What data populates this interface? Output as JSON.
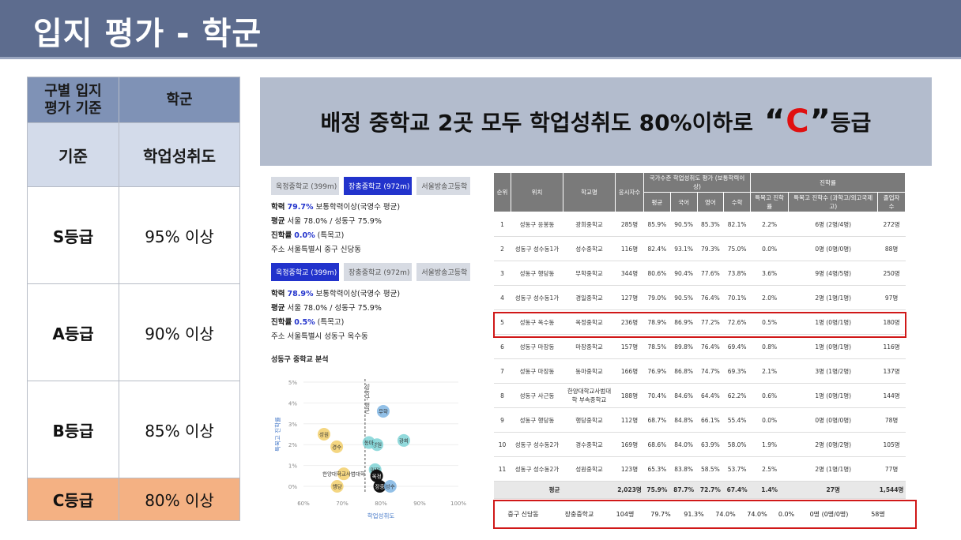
{
  "title": "입지 평가 - 학군",
  "grade_table": {
    "header_col1_line1": "구별 입지",
    "header_col1_line2": "평가 기준",
    "header_col2": "학군",
    "sub_col1": "기준",
    "sub_col2": "학업성취도",
    "rows": [
      {
        "grade": "S등급",
        "value": "95% 이상"
      },
      {
        "grade": "A등급",
        "value": "90% 이상"
      },
      {
        "grade": "B등급",
        "value": "85% 이상"
      },
      {
        "grade": "C등급",
        "value": "80% 이상"
      }
    ]
  },
  "banner": {
    "prefix": "배정 중학교 2곳 모두 학업성취도 80%이하로",
    "open_quote": "“",
    "grade": "C",
    "close_quote": "”",
    "suffix": "등급"
  },
  "panel1": {
    "tabs": [
      "옥정중학교 (399m)",
      "장충중학교 (972m)",
      "서울방송고등학"
    ],
    "active_tab": 1,
    "line1_label": "학력",
    "line1_value": "79.7%",
    "line1_rest": "보통학력이상(국영수 평균)",
    "line2_label": "평균",
    "line2_rest": "서울 78.0% / 성동구 75.9%",
    "line3_label": "진학률",
    "line3_value": "0.0%",
    "line3_rest": "(특목고)",
    "line4": "주소 서울특별시 중구 신당동"
  },
  "panel2": {
    "tabs": [
      "옥정중학교 (399m)",
      "장충중학교 (972m)",
      "서울방송고등학"
    ],
    "active_tab": 0,
    "line1_label": "학력",
    "line1_value": "78.9%",
    "line1_rest": "보통학력이상(국영수 평균)",
    "line2_label": "평균",
    "line2_rest": "서울 78.0% / 성동구 75.9%",
    "line3_label": "진학률",
    "line3_value": "0.5%",
    "line3_rest": "(특목고)",
    "line4": "주소 서울특별시 성동구 옥수동"
  },
  "chart_data": {
    "type": "scatter",
    "title": "성동구 중학교 분석",
    "xlabel": "학업성취도",
    "ylabel": "특목고 진학률",
    "xlim": [
      60,
      100
    ],
    "ylim": [
      0,
      5
    ],
    "x_ticks": [
      "60%",
      "70%",
      "80%",
      "90%",
      "100%"
    ],
    "y_ticks": [
      "0%",
      "1%",
      "2%",
      "3%",
      "4%",
      "5%"
    ],
    "ref_line_x": 75.9,
    "ref_line_label": "성동구 평균",
    "colors": {
      "yellow": "#f2cf6b",
      "teal": "#7fd3d6",
      "blue": "#7fb5e3",
      "black": "#111111"
    },
    "points": [
      {
        "label": "광희",
        "x": 85.9,
        "y": 2.2,
        "color": "teal"
      },
      {
        "label": "무학",
        "x": 80.6,
        "y": 3.6,
        "color": "blue"
      },
      {
        "label": "경일",
        "x": 79.0,
        "y": 2.0,
        "color": "teal"
      },
      {
        "label": "동마",
        "x": 76.9,
        "y": 2.1,
        "color": "teal"
      },
      {
        "label": "성원",
        "x": 65.3,
        "y": 2.5,
        "color": "yellow"
      },
      {
        "label": "경수",
        "x": 68.6,
        "y": 1.9,
        "color": "yellow"
      },
      {
        "label": "한양대학교사범대학",
        "x": 70.4,
        "y": 0.6,
        "color": "yellow"
      },
      {
        "label": "행당",
        "x": 68.7,
        "y": 0.0,
        "color": "yellow"
      },
      {
        "label": "마장",
        "x": 78.5,
        "y": 0.8,
        "color": "teal"
      },
      {
        "label": "옥정",
        "x": 78.9,
        "y": 0.5,
        "color": "black"
      },
      {
        "label": "장충",
        "x": 79.7,
        "y": 0.0,
        "color": "black"
      },
      {
        "label": "성수",
        "x": 82.4,
        "y": 0.0,
        "color": "blue"
      }
    ]
  },
  "school_table": {
    "top_headers": {
      "rank": "순위",
      "location": "위치",
      "school": "학교명",
      "takers": "응시자수",
      "achievement": "국가수준 학업성취도 평가 (보통학력이상)",
      "advance": "진학률"
    },
    "sub_headers": [
      "평균",
      "국어",
      "영어",
      "수학",
      "특목고 진학률",
      "특목고 진학수 (과학고/외고국제고)",
      "졸업자 수"
    ],
    "rows": [
      [
        "1",
        "성동구 응봉동",
        "광희중학교",
        "285명",
        "85.9%",
        "90.5%",
        "85.3%",
        "82.1%",
        "2.2%",
        "6명 (2명/4명)",
        "272명"
      ],
      [
        "2",
        "성동구 성수동1가",
        "성수중학교",
        "116명",
        "82.4%",
        "93.1%",
        "79.3%",
        "75.0%",
        "0.0%",
        "0명 (0명/0명)",
        "88명"
      ],
      [
        "3",
        "성동구 행당동",
        "무학중학교",
        "344명",
        "80.6%",
        "90.4%",
        "77.6%",
        "73.8%",
        "3.6%",
        "9명 (4명/5명)",
        "250명"
      ],
      [
        "4",
        "성동구 성수동1가",
        "경일중학교",
        "127명",
        "79.0%",
        "90.5%",
        "76.4%",
        "70.1%",
        "2.0%",
        "2명 (1명/1명)",
        "97명"
      ],
      [
        "5",
        "성동구 옥수동",
        "옥정중학교",
        "236명",
        "78.9%",
        "86.9%",
        "77.2%",
        "72.6%",
        "0.5%",
        "1명 (0명/1명)",
        "180명"
      ],
      [
        "6",
        "성동구 마장동",
        "마장중학교",
        "157명",
        "78.5%",
        "89.8%",
        "76.4%",
        "69.4%",
        "0.8%",
        "1명 (0명/1명)",
        "116명"
      ],
      [
        "7",
        "성동구 마장동",
        "동마중학교",
        "166명",
        "76.9%",
        "86.8%",
        "74.7%",
        "69.3%",
        "2.1%",
        "3명 (1명/2명)",
        "137명"
      ],
      [
        "8",
        "성동구 사근동",
        "한양대학교사범대학 부속중학교",
        "188명",
        "70.4%",
        "84.6%",
        "64.4%",
        "62.2%",
        "0.6%",
        "1명 (0명/1명)",
        "144명"
      ],
      [
        "9",
        "성동구 행당동",
        "행당중학교",
        "112명",
        "68.7%",
        "84.8%",
        "66.1%",
        "55.4%",
        "0.0%",
        "0명 (0명/0명)",
        "78명"
      ],
      [
        "10",
        "성동구 성수동2가",
        "경수중학교",
        "169명",
        "68.6%",
        "84.0%",
        "63.9%",
        "58.0%",
        "1.9%",
        "2명 (0명/2명)",
        "105명"
      ],
      [
        "11",
        "성동구 성수동2가",
        "성원중학교",
        "123명",
        "65.3%",
        "83.8%",
        "58.5%",
        "53.7%",
        "2.5%",
        "2명 (1명/1명)",
        "77명"
      ]
    ],
    "average": [
      "평균",
      "2,023명",
      "75.9%",
      "87.7%",
      "72.7%",
      "67.4%",
      "1.4%",
      "27명",
      "1,544명"
    ],
    "jangchung": [
      "중구 신당동",
      "장충중학교",
      "104명",
      "79.7%",
      "91.3%",
      "74.0%",
      "74.0%",
      "0.0%",
      "0명 (0명/0명)",
      "58명"
    ]
  }
}
